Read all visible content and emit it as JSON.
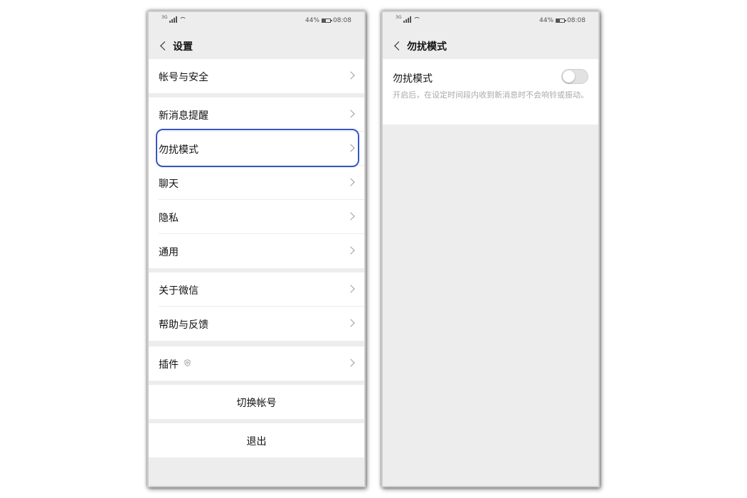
{
  "status_bar": {
    "network": "3G",
    "battery": "44%",
    "battery_level": 0.44,
    "time": "08:08"
  },
  "left_screen": {
    "title": "设置",
    "groups": [
      {
        "items": [
          {
            "label": "帐号与安全"
          }
        ]
      },
      {
        "items": [
          {
            "label": "新消息提醒"
          },
          {
            "label": "勿扰模式",
            "highlighted": true
          },
          {
            "label": "聊天"
          },
          {
            "label": "隐私"
          },
          {
            "label": "通用"
          }
        ]
      },
      {
        "items": [
          {
            "label": "关于微信"
          },
          {
            "label": "帮助与反馈"
          }
        ]
      },
      {
        "items": [
          {
            "label": "插件",
            "icon": "shield-icon"
          }
        ]
      }
    ],
    "switch_account": "切换帐号",
    "logout": "退出"
  },
  "right_screen": {
    "title": "勿扰模式",
    "setting": {
      "label": "勿扰模式",
      "description": "开启后，在设定时间段内收到新消息时不会响铃或振动。",
      "enabled": false
    }
  },
  "colors": {
    "highlight_border": "#3556c8",
    "background": "#ededed",
    "card": "#ffffff",
    "desc_text": "#a9a9a9"
  }
}
